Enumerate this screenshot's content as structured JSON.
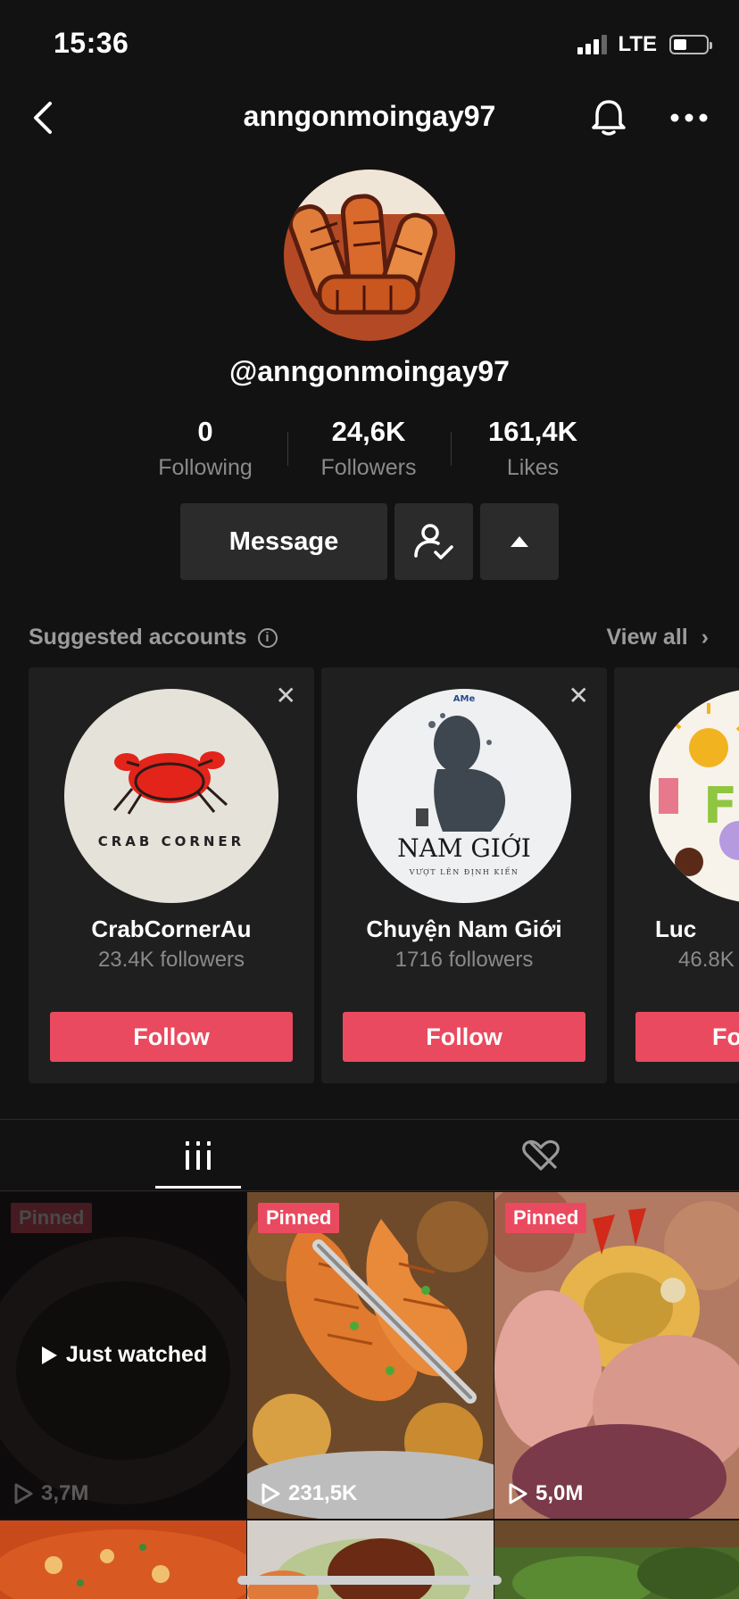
{
  "status": {
    "time": "15:36",
    "network": "LTE"
  },
  "header": {
    "title": "anngonmoingay97"
  },
  "profile": {
    "handle": "@anngonmoingay97"
  },
  "stats": [
    {
      "value": "0",
      "label": "Following"
    },
    {
      "value": "24,6K",
      "label": "Followers"
    },
    {
      "value": "161,4K",
      "label": "Likes"
    }
  ],
  "actions": {
    "message_label": "Message"
  },
  "suggested": {
    "title": "Suggested accounts",
    "view_all": "View all",
    "accounts": [
      {
        "name": "CrabCornerAu",
        "followers": "23.4K followers",
        "follow_label": "Follow",
        "logo_text": "CRAB CORNER"
      },
      {
        "name": "Chuyện Nam Giới",
        "followers": "1716 followers",
        "follow_label": "Follow",
        "logo_text": "NAM GIỚI",
        "logo_subtext": "VƯỢT LÊN ĐỊNH KIẾN",
        "logo_badge": "AMe"
      },
      {
        "name": "Luc",
        "followers": "46.8K",
        "follow_label": "Fo"
      }
    ]
  },
  "videos": [
    {
      "pinned": "Pinned",
      "views": "3,7M",
      "overlay": "Just watched"
    },
    {
      "pinned": "Pinned",
      "views": "231,5K"
    },
    {
      "pinned": "Pinned",
      "views": "5,0M"
    }
  ],
  "colors": {
    "accent": "#ea4a5f",
    "background": "#121212",
    "card": "#1f1f1f"
  }
}
